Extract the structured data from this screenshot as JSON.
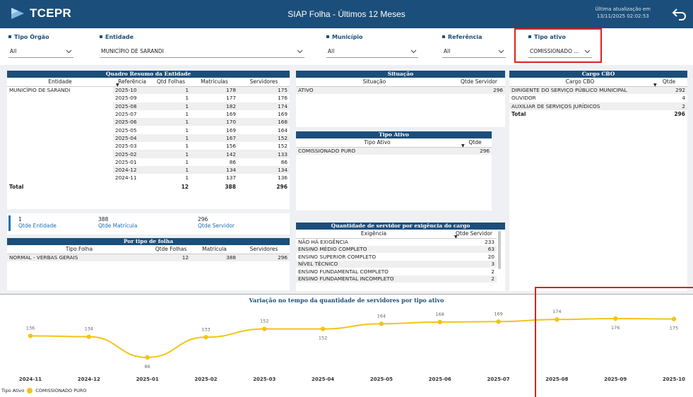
{
  "header": {
    "logo_text": "TCEPR",
    "title": "SIAP Folha - Últimos 12 Meses",
    "update_label": "Última atualização em",
    "update_value": "13/11/2025 02:02:53"
  },
  "filters": {
    "tipo_orgao": {
      "label": "Tipo Órgão",
      "value": "All"
    },
    "entidade": {
      "label": "Entidade",
      "value": "MUNICÍPIO DE SARANDI"
    },
    "municipio": {
      "label": "Município",
      "value": "All"
    },
    "referencia": {
      "label": "Referência",
      "value": "All"
    },
    "tipo_ativo": {
      "label": "Tipo ativo",
      "value": "COMISSIONADO ..."
    }
  },
  "quadro": {
    "title": "Quadro Resumo da Entidade",
    "headers": [
      "Entidade",
      "Referência",
      "Qtd Folhas",
      "Matrículas",
      "Servidores"
    ],
    "entity": "MUNICÍPIO DE SARANDI",
    "rows": [
      [
        "2025-10",
        "1",
        "178",
        "175"
      ],
      [
        "2025-09",
        "1",
        "177",
        "176"
      ],
      [
        "2025-08",
        "1",
        "182",
        "174"
      ],
      [
        "2025-07",
        "1",
        "169",
        "169"
      ],
      [
        "2025-06",
        "1",
        "170",
        "168"
      ],
      [
        "2025-05",
        "1",
        "169",
        "164"
      ],
      [
        "2025-04",
        "1",
        "167",
        "152"
      ],
      [
        "2025-03",
        "1",
        "156",
        "152"
      ],
      [
        "2025-02",
        "1",
        "142",
        "133"
      ],
      [
        "2025-01",
        "1",
        "86",
        "86"
      ],
      [
        "2024-12",
        "1",
        "134",
        "134"
      ],
      [
        "2024-11",
        "1",
        "137",
        "136"
      ]
    ],
    "total": {
      "label": "Total",
      "folhas": "12",
      "matriculas": "388",
      "servidores": "296"
    }
  },
  "kpis": {
    "entidade": {
      "value": "1",
      "label": "Qtde Entidade"
    },
    "matricula": {
      "value": "388",
      "label": "Qtde Matrícula"
    },
    "servidor": {
      "value": "296",
      "label": "Qtde Servidor"
    }
  },
  "folha": {
    "title": "Por tipo de folha",
    "headers": [
      "Tipo Folha",
      "Qtde Folhas",
      "Matrícula",
      "Servidores"
    ],
    "rows": [
      [
        "NORMAL - VERBAS GERAIS",
        "12",
        "388",
        "296"
      ]
    ]
  },
  "situacao": {
    "title": "Situação",
    "headers": [
      "Situação",
      "Qtde Servidor"
    ],
    "rows": [
      [
        "ATIVO",
        "296"
      ]
    ]
  },
  "tipo_ativo_table": {
    "title": "Tipo Ativo",
    "headers": [
      "Tipo Ativo",
      "Qtde"
    ],
    "rows": [
      [
        "COMISSIONADO PURO",
        "296"
      ]
    ]
  },
  "exigencia": {
    "title": "Quantidade de servidor por exigência do cargo",
    "headers": [
      "Exigência",
      "Qtde Servidor"
    ],
    "rows": [
      [
        "NÃO HÁ EXIGÊNCIA",
        "233"
      ],
      [
        "ENSINO MÉDIO COMPLETO",
        "63"
      ],
      [
        "ENSINO SUPERIOR COMPLETO",
        "20"
      ],
      [
        "NÍVEL TÉCNICO",
        "3"
      ],
      [
        "ENSINO FUNDAMENTAL COMPLETO",
        "2"
      ],
      [
        "ENSINO FUNDAMENTAL INCOMPLETO",
        "2"
      ]
    ]
  },
  "cargo": {
    "title": "Cargo CBO",
    "headers": [
      "Cargo CBO",
      "Qtde"
    ],
    "rows": [
      [
        "DIRIGENTE DO SERVIÇO PÚBLICO MUNICIPAL",
        "292"
      ],
      [
        "OUVIDOR",
        "4"
      ],
      [
        "AUXILIAR DE SERVIÇOS JURÍDICOS",
        "2"
      ]
    ],
    "total": {
      "label": "Total",
      "value": "296"
    }
  },
  "colors": {
    "header": "#1b4e7a",
    "series": "#f2c418",
    "highlight": "#e02020"
  },
  "chart_data": {
    "type": "line",
    "title": "Variação no tempo da quantidade de servidores por tipo ativo",
    "legend_title": "Tipo Ativo",
    "categories": [
      "2024-11",
      "2024-12",
      "2025-01",
      "2025-02",
      "2025-03",
      "2025-04",
      "2025-05",
      "2025-06",
      "2025-07",
      "2025-08",
      "2025-09",
      "2025-10"
    ],
    "series": [
      {
        "name": "COMISSIONADO PURO",
        "values": [
          136,
          134,
          86,
          133,
          152,
          152,
          164,
          168,
          169,
          174,
          176,
          175
        ]
      }
    ]
  }
}
